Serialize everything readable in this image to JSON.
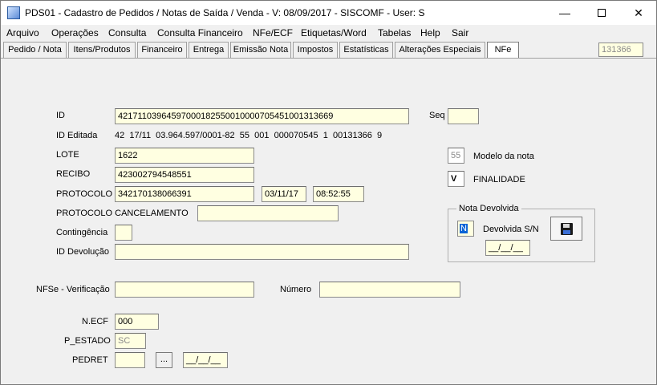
{
  "window": {
    "title": "PDS01 - Cadastro de Pedidos / Notas de Saída / Venda - V: 08/09/2017 - SISCOMF - User: S",
    "minimize": "—",
    "close": "✕"
  },
  "menu": [
    {
      "label": "Arquivo"
    },
    {
      "label": "Operações"
    },
    {
      "label": "Consulta"
    },
    {
      "label": "Consulta Financeiro"
    },
    {
      "label": "NFe/ECF"
    },
    {
      "label": "Etiquetas/Word"
    },
    {
      "label": "Tabelas"
    },
    {
      "label": "Help"
    },
    {
      "label": "Sair"
    }
  ],
  "tabs": [
    {
      "label": "Pedido / Nota"
    },
    {
      "label": "Itens/Produtos"
    },
    {
      "label": "Financeiro"
    },
    {
      "label": "Entrega"
    },
    {
      "label": "Emissão Nota"
    },
    {
      "label": "Impostos"
    },
    {
      "label": "Estatísticas"
    },
    {
      "label": "Alterações Especiais"
    },
    {
      "label": "NFe"
    }
  ],
  "active_tab": "NFe",
  "counter": "131366",
  "form": {
    "id_label": "ID",
    "id_value": "42171103964597000182550010000705451001313669",
    "seq_label": "Seq",
    "seq_value": "",
    "id_editada_label": "ID Editada",
    "id_editada_value": "42  17/11  03.964.597/0001-82  55  001  000070545  1  00131366  9",
    "lote_label": "LOTE",
    "lote_value": "1622",
    "modelo_value": "55",
    "modelo_label": "Modelo da nota",
    "recibo_label": "RECIBO",
    "recibo_value": "423002794548551",
    "finalidade_value": "V",
    "finalidade_label": "FINALIDADE",
    "protocolo_label": "PROTOCOLO",
    "protocolo_value": "342170138066391",
    "protocolo_date": "03/11/17",
    "protocolo_time": "08:52:55",
    "protocolo_cancel_label": "PROTOCOLO CANCELAMENTO",
    "protocolo_cancel_value": "",
    "contingencia_label": "Contingência",
    "contingencia_value": "",
    "id_devolucao_label": "ID Devolução",
    "id_devolucao_value": "",
    "nfse_label": "NFSe - Verificação",
    "nfse_value": "",
    "numero_label": "Número",
    "numero_value": "",
    "necf_label": "N.ECF",
    "necf_value": "000",
    "pestado_label": "P_ESTADO",
    "pestado_value": "SC",
    "pedret_label": "PEDRET",
    "pedret_value": "",
    "pedret_button": "...",
    "pedret_date": "__/__/__"
  },
  "devolvida_group": {
    "title": "Nota Devolvida",
    "flag_value": "N",
    "flag_label": "Devolvida S/N",
    "date_value": "__/__/__",
    "save_icon": "floppy-disk-icon"
  }
}
